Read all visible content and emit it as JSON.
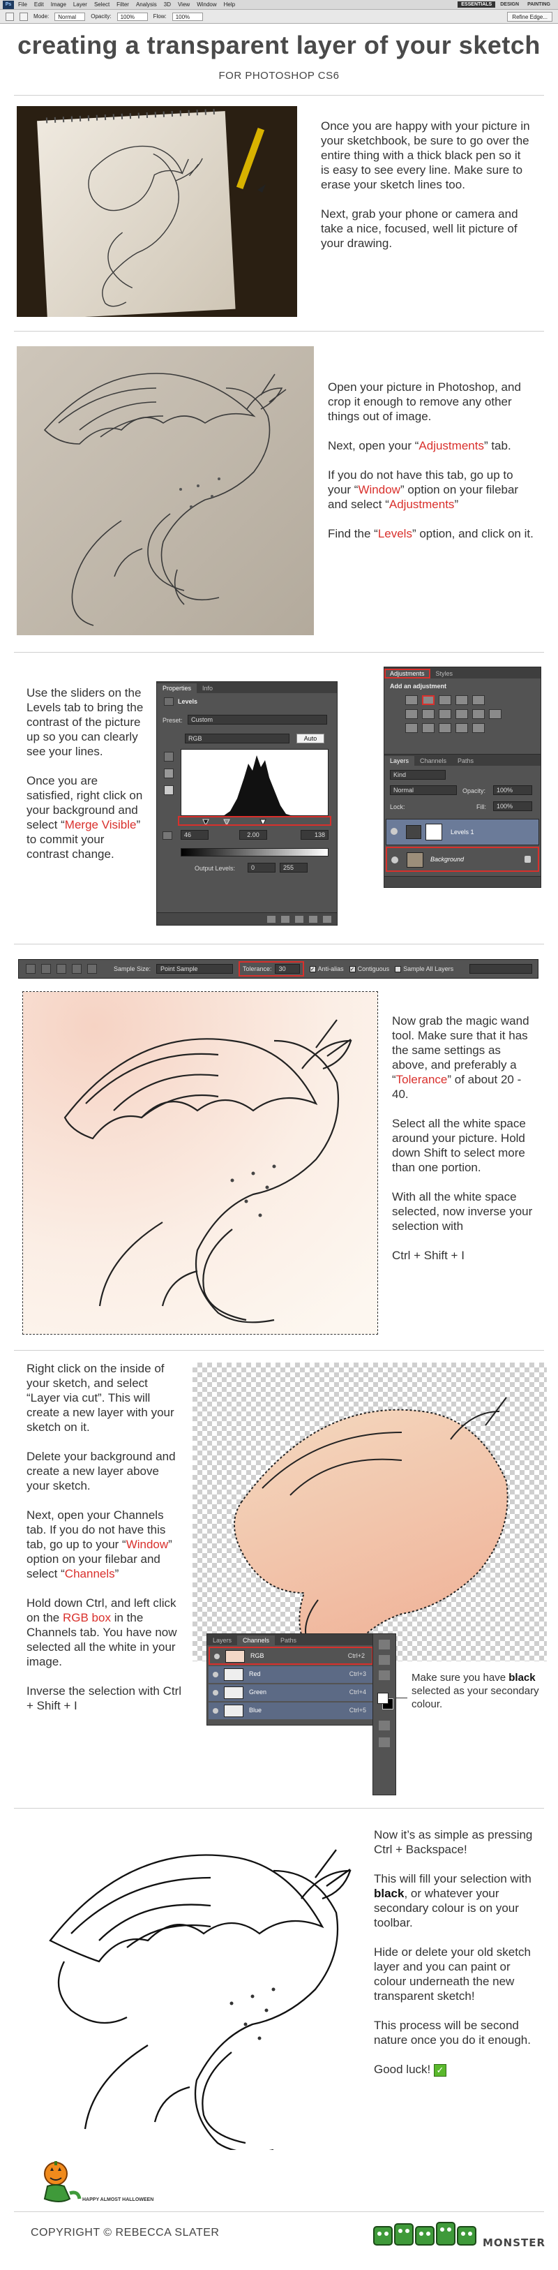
{
  "ps": {
    "logo": "Ps",
    "menu": [
      "File",
      "Edit",
      "Image",
      "Layer",
      "Select",
      "Filter",
      "Analysis",
      "3D",
      "View",
      "Window",
      "Help"
    ],
    "workspaces": [
      "ESSENTIALS",
      "DESIGN",
      "PAINTING"
    ],
    "options": {
      "mode_label": "Mode:",
      "mode_value": "Normal",
      "opacity_label": "Opacity:",
      "opacity_value": "100%",
      "flow_label": "Flow:",
      "flow_value": "100%",
      "refine_edge": "Refine Edge..."
    }
  },
  "header": {
    "title": "creating a transparent layer of your sketch",
    "subtitle": "FOR PHOTOSHOP CS6"
  },
  "sections": {
    "s1": {
      "p1": "Once you are happy with your picture in your sketchbook, be sure to go over the entire thing with a thick black pen so it is easy to see every line. Make sure to erase your sketch lines too.",
      "p2": "Next, grab your phone or camera and take a nice, focused, well lit picture of your drawing."
    },
    "s2": {
      "p1": "Open your picture in Photoshop, and crop it enough to remove any other things out of image.",
      "p2a": "Next, open your “",
      "p2hl": "Adjustments",
      "p2b": "” tab.",
      "p3a": "If you do not have this tab, go up to your “",
      "p3hl1": "Window",
      "p3b": "” option on your filebar and select “",
      "p3hl2": "Adjustments",
      "p3c": "”",
      "p4a": "Find the “",
      "p4hl": "Levels",
      "p4b": "” option, and click on it."
    },
    "s3": {
      "p1": "Use the sliders on the Levels tab to bring the contrast of the picture up so you can clearly see your lines.",
      "p2a": "Once you are satisfied, right click on your background and select “",
      "p2hl": "Merge Visible",
      "p2b": "” to commit your contrast change."
    },
    "s4": {
      "p1a": "Now grab the magic wand tool. Make sure that it has the same settings as above, and preferably a “",
      "p1hl": "Tolerance",
      "p1b": "” of about 20 - 40.",
      "p2": "Select all the white space around your picture. Hold down Shift to select more than one portion.",
      "p3": "With all the white space selected, now inverse your selection with",
      "p4": "Ctrl + Shift + I"
    },
    "s5": {
      "p1": "Right click on the inside of your sketch, and select “Layer via cut”. This will create a new layer with your sketch on it.",
      "p2": "Delete your background and create a new layer above your sketch.",
      "p3a": "Next, open your Channels tab. If you do not have this tab, go up to your “",
      "p3hl1": "Window",
      "p3b": "” option on your filebar and select “",
      "p3hl2": "Channels",
      "p3c": "”",
      "p4a": "Hold down Ctrl, and left click on the ",
      "p4hl": "RGB box",
      "p4b": " in the Channels tab. You have now selected all the white in your image.",
      "p5": "Inverse the selection with Ctrl + Shift + I",
      "side_a": "Make sure you have ",
      "side_b": "black",
      "side_c": " selected as your secondary colour."
    },
    "s6": {
      "p1": "Now it’s as simple as pressing Ctrl + Backspace!",
      "p2a": "This will fill your selection with ",
      "p2b": "black",
      "p2c": ", or whatever your secondary colour is on your toolbar.",
      "p3": "Hide or delete your old sketch layer and you can paint or colour underneath the new transparent sketch!",
      "p4": "This process will be second nature once you do it enough.",
      "p5": "Good luck!"
    }
  },
  "panels": {
    "properties": {
      "tabs": [
        "Properties",
        "Info"
      ],
      "heading": "Levels",
      "preset_label": "Preset:",
      "preset_value": "Custom",
      "channel_value": "RGB",
      "auto_label": "Auto",
      "input_values": [
        "46",
        "2.00",
        "138"
      ],
      "output_label": "Output Levels:",
      "output_values": [
        "0",
        "255"
      ]
    },
    "adjustments": {
      "tabs": [
        "Adjustments",
        "Styles"
      ],
      "hint": "Add an adjustment"
    },
    "layers": {
      "tabs": [
        "Layers",
        "Channels",
        "Paths"
      ],
      "kind_label": "Kind",
      "blend_mode": "Normal",
      "opacity_label": "Opacity:",
      "opacity_value": "100%",
      "lock_label": "Lock:",
      "fill_label": "Fill:",
      "fill_value": "100%",
      "layer_names": [
        "Levels 1",
        "Background"
      ]
    },
    "channels": {
      "tabs": [
        "Layers",
        "Channels",
        "Paths"
      ],
      "rows": [
        {
          "name": "RGB",
          "shortcut": "Ctrl+2"
        },
        {
          "name": "Red",
          "shortcut": "Ctrl+3"
        },
        {
          "name": "Green",
          "shortcut": "Ctrl+4"
        },
        {
          "name": "Blue",
          "shortcut": "Ctrl+5"
        }
      ]
    }
  },
  "wandbar": {
    "sample_size_label": "Sample Size:",
    "sample_size_value": "Point Sample",
    "tolerance_label": "Tolerance:",
    "tolerance_value": "30",
    "antialias_label": "Anti-alias",
    "contiguous_label": "Contiguous",
    "sample_all_label": "Sample All Layers"
  },
  "footer": {
    "copyright": "COPYRIGHT © REBECCA SLATER",
    "halloween": "HAPPY ALMOST HALLOWEEN",
    "brand": "MONSTER"
  },
  "colors": {
    "accent_red": "#d9302c",
    "panel_gray": "#535353",
    "brand_green": "#3f9a3a"
  }
}
